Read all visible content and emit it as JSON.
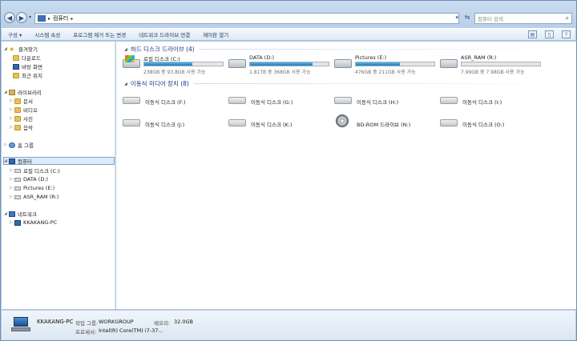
{
  "address": {
    "crumbs": [
      "컴퓨터"
    ],
    "search_placeholder": "컴퓨터 검색"
  },
  "toolbar": {
    "items": [
      "구성 ▾",
      "시스템 속성",
      "프로그램 제거 또는 변경",
      "네트워크 드라이브 연결",
      "제어판 열기"
    ]
  },
  "nav": {
    "favorites": "즐겨찾기",
    "downloads": "다운로드",
    "desktop": "바탕 화면",
    "recent": "최근 위치",
    "libraries": "라이브러리",
    "documents": "문서",
    "videos": "비디오",
    "pictures": "사진",
    "music": "음악",
    "homegroup": "홈 그룹",
    "computer": "컴퓨터",
    "drive_c": "로컬 디스크 (C:)",
    "drive_d": "DATA (D:)",
    "drive_e": "Pictures (E:)",
    "drive_r": "ASR_RAM (R:)",
    "network": "네트워크",
    "net_pc": "KKAKANG-PC"
  },
  "hdd_group": {
    "title": "하드 디스크 드라이브 (4)",
    "drives": [
      {
        "name": "로컬 디스크 (C:)",
        "info": "238GB 중 93.8GB 사용 가능",
        "used_fraction": 0.61,
        "system": true
      },
      {
        "name": "DATA (D:)",
        "info": "1.81TB 중 368GB 사용 가능",
        "used_fraction": 0.8,
        "system": false
      },
      {
        "name": "Pictures (E:)",
        "info": "476GB 중 211GB 사용 가능",
        "used_fraction": 0.56,
        "system": false
      },
      {
        "name": "ASR_RAM (R:)",
        "info": "7.99GB 중 7.98GB 사용 가능",
        "used_fraction": 0.0,
        "system": false
      }
    ]
  },
  "removable_group": {
    "title": "이동식 미디어 장치 (8)",
    "items": [
      "이동식 디스크 (F:)",
      "이동식 디스크 (G:)",
      "이동식 디스크 (H:)",
      "이동식 디스크 (I:)",
      "이동식 디스크 (J:)",
      "이동식 디스크 (K:)",
      "BD-ROM 드라이브 (N:)",
      "이동식 디스크 (O:)"
    ]
  },
  "details": {
    "pc_name": "KKAKANG-PC",
    "workgroup_label": "작업 그룹:",
    "workgroup": "WORKGROUP",
    "memory_label": "메모리:",
    "memory": "32.0GB",
    "processor_label": "프로세서:",
    "processor": "Intel(R) Core(TM) i7-37..."
  }
}
